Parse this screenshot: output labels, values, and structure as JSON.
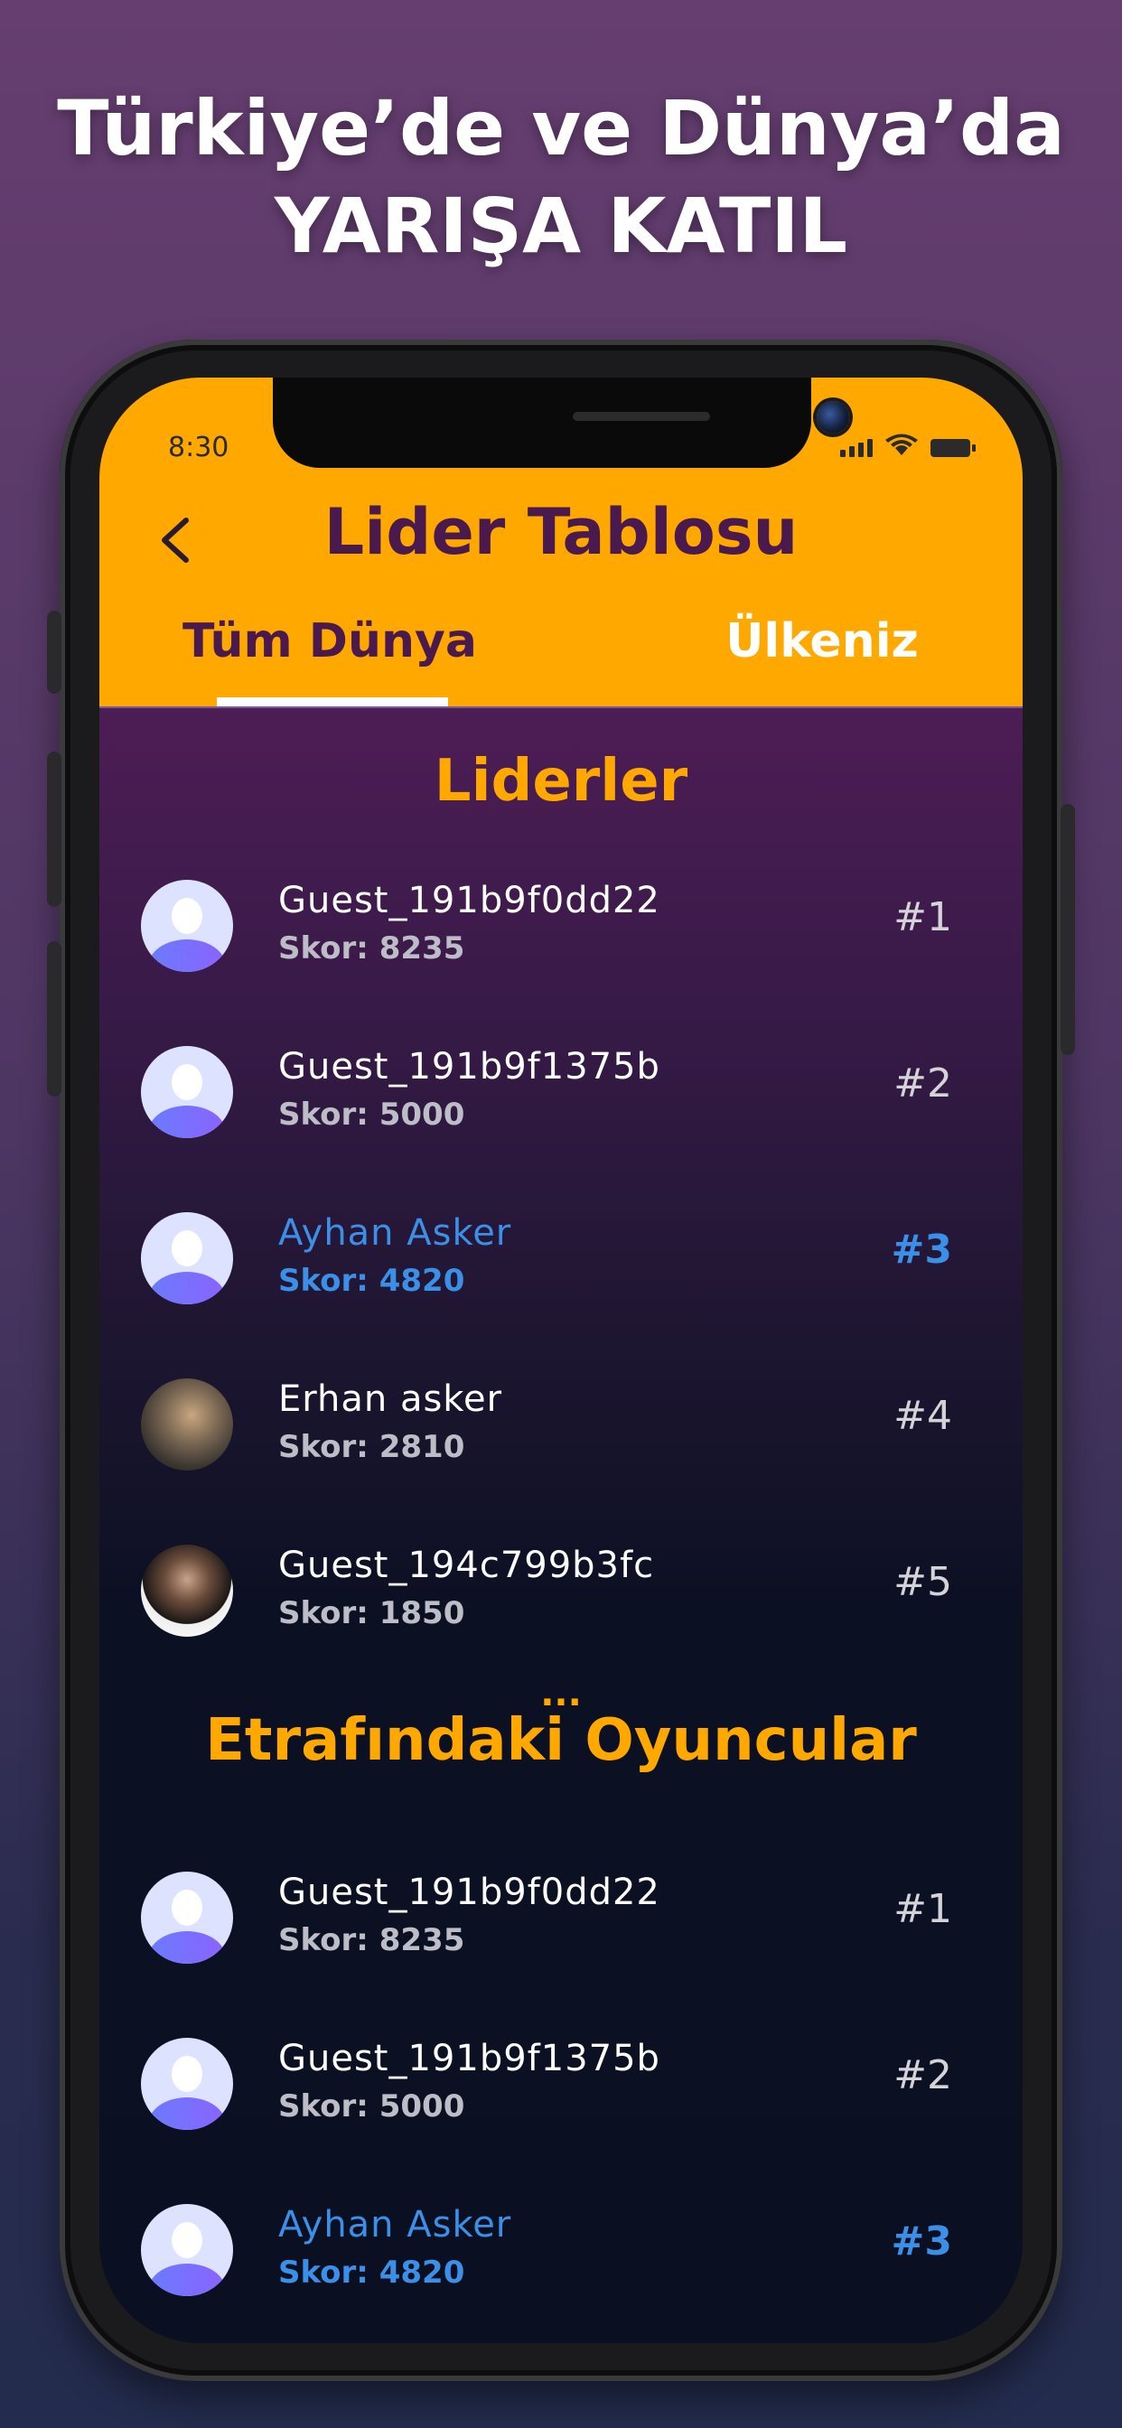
{
  "promo": {
    "line1": "Türkiye’de ve Dünya’da",
    "line2": "YARIŞA KATIL"
  },
  "status_bar": {
    "time": "8:30"
  },
  "app_bar": {
    "title": "Lider Tablosu",
    "back_icon": "chevron-left-icon",
    "tabs": [
      {
        "label": "Tüm Dünya",
        "selected": true
      },
      {
        "label": "Ülkeniz",
        "selected": false
      }
    ]
  },
  "leaders": {
    "title": "Liderler",
    "rows": [
      {
        "name": "Guest_191b9f0dd22",
        "score": "Skor: 8235",
        "rank": "#1",
        "current_user": false,
        "avatar": "default-avatar-icon"
      },
      {
        "name": "Guest_191b9f1375b",
        "score": "Skor: 5000",
        "rank": "#2",
        "current_user": false,
        "avatar": "default-avatar-icon"
      },
      {
        "name": "Ayhan Asker",
        "score": "Skor: 4820",
        "rank": "#3",
        "current_user": true,
        "avatar": "default-avatar-icon"
      },
      {
        "name": "Erhan asker",
        "score": "Skor: 2810",
        "rank": "#4",
        "current_user": false,
        "avatar": "photo-avatar"
      },
      {
        "name": "Guest_194c799b3fc",
        "score": "Skor: 1850",
        "rank": "#5",
        "current_user": false,
        "avatar": "photo-avatar"
      }
    ],
    "ellipsis": "..."
  },
  "nearby": {
    "title": "Etrafındaki Oyuncular",
    "rows": [
      {
        "name": "Guest_191b9f0dd22",
        "score": "Skor: 8235",
        "rank": "#1",
        "current_user": false,
        "avatar": "default-avatar-icon"
      },
      {
        "name": "Guest_191b9f1375b",
        "score": "Skor: 5000",
        "rank": "#2",
        "current_user": false,
        "avatar": "default-avatar-icon"
      },
      {
        "name": "Ayhan Asker",
        "score": "Skor: 4820",
        "rank": "#3",
        "current_user": true,
        "avatar": "default-avatar-icon"
      }
    ]
  },
  "colors": {
    "accent": "#ffa800",
    "title_text": "#4a1a4e",
    "highlight": "#3b8fe6"
  }
}
